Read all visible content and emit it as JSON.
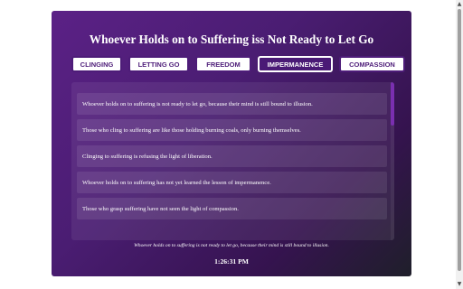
{
  "title": "Whoever Holds on to Suffering iss Not Ready to Let Go",
  "tabs": [
    {
      "label": "CLINGING"
    },
    {
      "label": "LETTING GO"
    },
    {
      "label": "FREEDOM"
    },
    {
      "label": "IMPERMANENCE",
      "active": true
    },
    {
      "label": "COMPASSION"
    }
  ],
  "quotes": [
    "Whoever holds on to suffering is not ready to let go, because their mind is still bound to illusion.",
    "Those who cling to suffering are like those holding burning coals, only burning themselves.",
    "Clinging to suffering is refusing the light of liberation.",
    "Whoever holds on to suffering has not yet learned the lesson of impermanence.",
    "Those who grasp suffering have not seen the light of compassion."
  ],
  "footer_quote": "Whoever holds on to suffering is not ready to let go, because their mind is still bound to illusion.",
  "time": "1:26:31 PM",
  "scrollbar": {
    "up_icon": "▲",
    "down_icon": "▼"
  }
}
